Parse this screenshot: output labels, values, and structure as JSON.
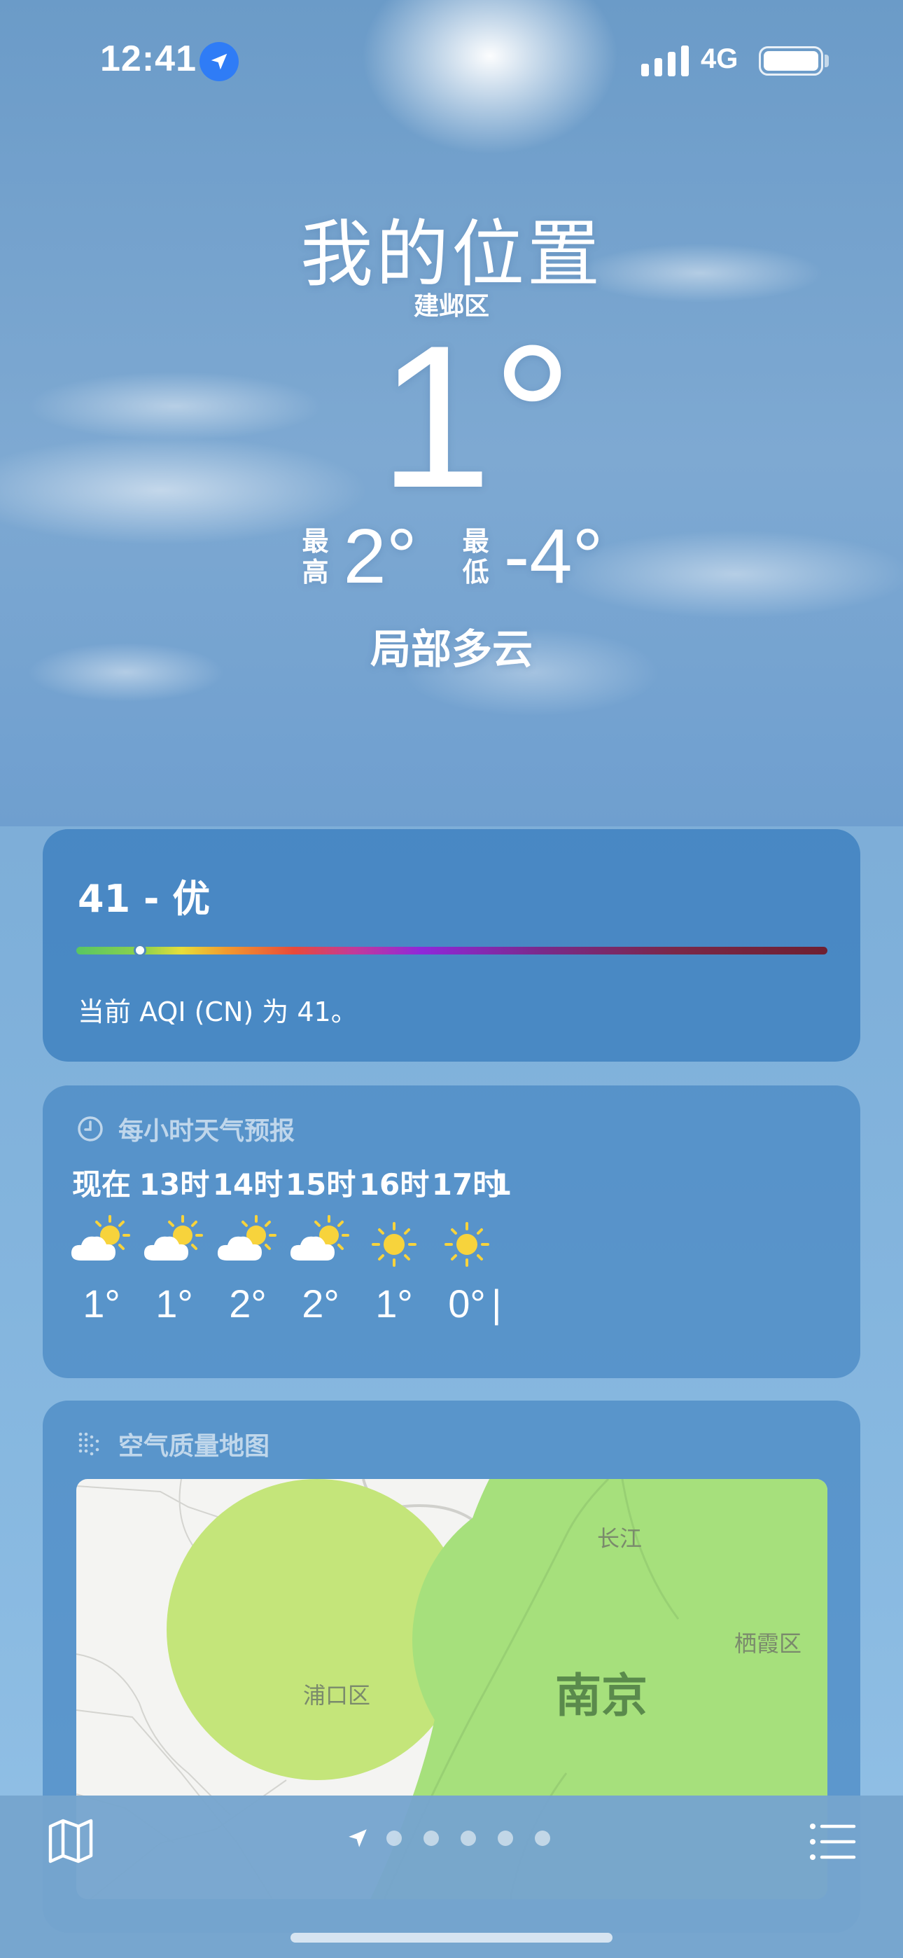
{
  "status_bar": {
    "time": "12:41",
    "network": "4G",
    "battery_level": 1.0
  },
  "header": {
    "location_title": "我的位置",
    "district": "建邺区",
    "current_temp": "1°",
    "high_label": "最高",
    "high_label_top": "最",
    "high_label_bottom": "高",
    "high_temp": "2°",
    "low_label_top": "最",
    "low_label_bottom": "低",
    "low_temp": "-4°",
    "condition": "局部多云"
  },
  "aqi_card": {
    "value_text": "41 - 优",
    "aqi_value": 41,
    "scale_position": 0.085,
    "description": "当前 AQI (CN) 为 41。"
  },
  "hourly_card": {
    "title": "每小时天气预报",
    "hours": [
      {
        "label": "现在",
        "icon": "partly-cloudy-icon",
        "temp": "1°"
      },
      {
        "label": "13时",
        "icon": "partly-cloudy-icon",
        "temp": "1°"
      },
      {
        "label": "14时",
        "icon": "partly-cloudy-icon",
        "temp": "2°"
      },
      {
        "label": "15时",
        "icon": "partly-cloudy-icon",
        "temp": "2°"
      },
      {
        "label": "16时",
        "icon": "sun-icon",
        "temp": "1°"
      },
      {
        "label": "17时",
        "icon": "sun-icon",
        "temp": "0°"
      },
      {
        "label": "1",
        "icon": "",
        "temp": "|"
      }
    ]
  },
  "map_card": {
    "title": "空气质量地图",
    "labels": {
      "river": "长江",
      "district_east": "栖霞区",
      "district_west": "浦口区",
      "city": "南京"
    },
    "aqi_fill_colors": [
      "#c4e57a",
      "#a6e07c"
    ]
  },
  "bottom_bar": {
    "page_count": 5,
    "current_page": 0
  },
  "colors": {
    "accent_location": "#2f7cf6",
    "sun_yellow": "#f7d33c"
  }
}
